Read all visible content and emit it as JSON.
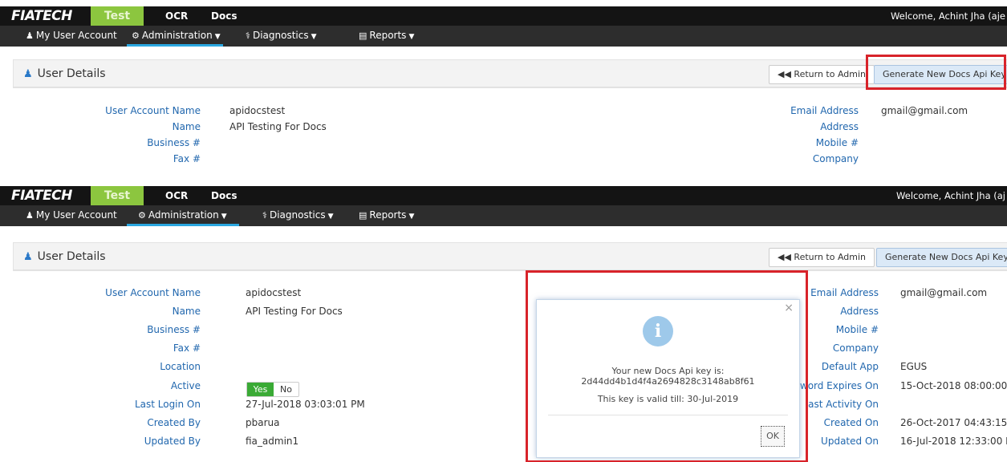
{
  "brand": {
    "logo": "FIATECH",
    "env": "Test"
  },
  "top_links": [
    "OCR",
    "Docs"
  ],
  "screen1_welcome": "Welcome, Achint Jha (aje",
  "screen2_welcome": "Welcome, Achint Jha (aj",
  "nav": [
    {
      "label": "My User Account",
      "icon": "user-icon"
    },
    {
      "label": "Administration",
      "icon": "cogs-icon",
      "active": true
    },
    {
      "label": "Diagnostics",
      "icon": "stethoscope-icon"
    },
    {
      "label": "Reports",
      "icon": "list-icon"
    }
  ],
  "panel": {
    "title": "User Details",
    "return_label": "Return to Admin",
    "generate_label": "Generate New Docs Api Key"
  },
  "left_fields": [
    {
      "label": "User Account Name",
      "value": "apidocstest"
    },
    {
      "label": "Name",
      "value": "API Testing For Docs"
    },
    {
      "label": "Business #",
      "value": ""
    },
    {
      "label": "Fax #",
      "value": ""
    },
    {
      "label": "Location",
      "value": ""
    },
    {
      "label": "Active",
      "value": ""
    },
    {
      "label": "Last Login On",
      "value": "27-Jul-2018 03:03:01 PM"
    },
    {
      "label": "Created By",
      "value": "pbarua"
    },
    {
      "label": "Updated By",
      "value": "fia_admin1"
    }
  ],
  "right_fields": [
    {
      "label": "Email Address",
      "value": "gmail@gmail.com"
    },
    {
      "label": "Address",
      "value": ""
    },
    {
      "label": "Mobile #",
      "value": ""
    },
    {
      "label": "Company",
      "value": ""
    },
    {
      "label": "Default App",
      "value": "EGUS"
    },
    {
      "label": "word Expires On",
      "value": "15-Oct-2018 08:00:00 F"
    },
    {
      "label": "ast Activity On",
      "value": ""
    },
    {
      "label": "Created On",
      "value": "26-Oct-2017 04:43:15 F"
    },
    {
      "label": "Updated On",
      "value": "16-Jul-2018 12:33:00 P"
    }
  ],
  "active_toggle": {
    "yes": "Yes",
    "no": "No",
    "selected": "Yes"
  },
  "modal": {
    "close": "×",
    "icon": "info-icon",
    "line1": "Your new Docs Api key is:",
    "api_key": "2d44dd4b1d4f4a2694828c3148ab8f61",
    "valid_till": "This key is valid till: 30-Jul-2019",
    "ok_label": "OK"
  },
  "colors": {
    "accent": "#2aa7e0",
    "env_green": "#8cc63f",
    "link_blue": "#2167ae",
    "highlight_red": "#d8232a",
    "toggle_green": "#3aaa35"
  }
}
